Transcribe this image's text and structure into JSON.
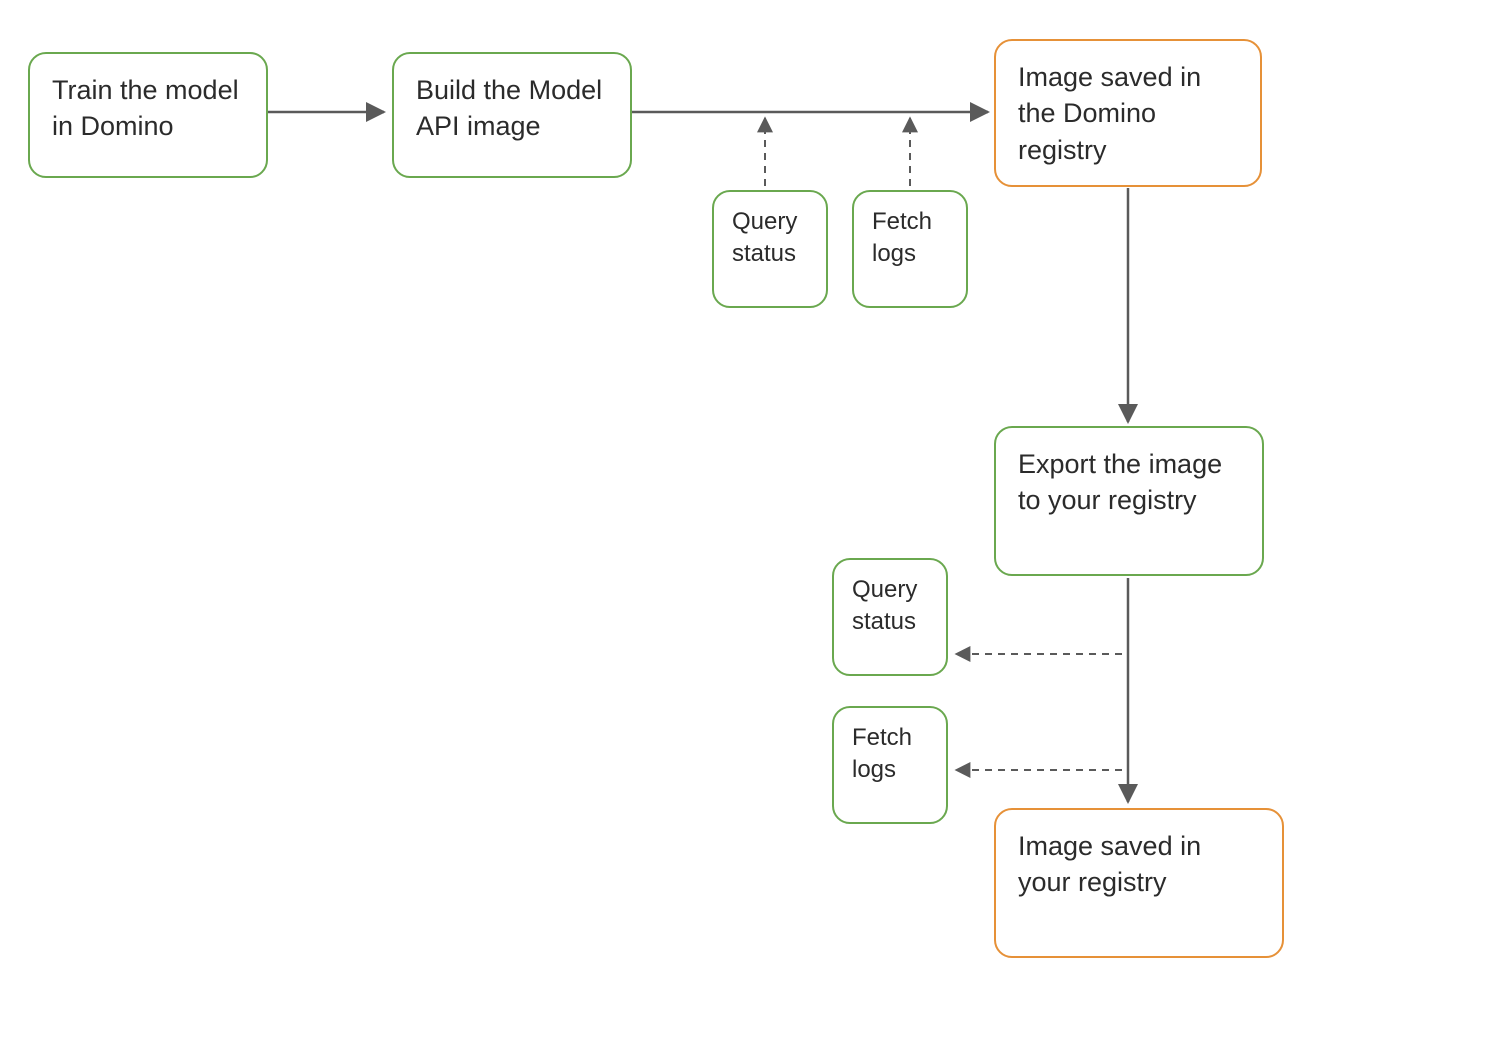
{
  "nodes": {
    "train": "Train the model in Domino",
    "build": "Build the Model API image",
    "saved_domino": "Image saved in the Domino registry",
    "query1": "Query status",
    "fetch1": "Fetch logs",
    "export": "Export the image to your registry",
    "query2": "Query status",
    "fetch2": "Fetch logs",
    "saved_your": "Image saved in your registry"
  },
  "colors": {
    "green": "#6aa84f",
    "orange": "#e69138",
    "arrow": "#5a5a5a"
  }
}
